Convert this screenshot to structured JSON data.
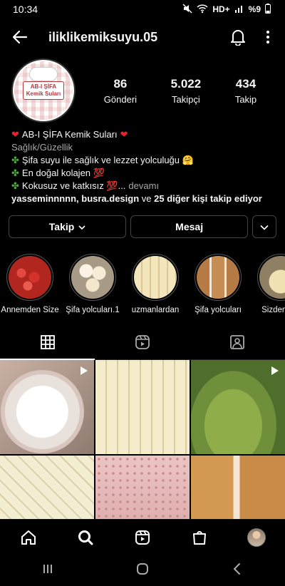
{
  "status_bar": {
    "time": "10:34",
    "network": "HD+",
    "battery": "%9"
  },
  "header": {
    "username": "iliklikemiksuyu.05"
  },
  "profile": {
    "avatar_text_line1": "AB-I ŞİFA",
    "avatar_text_line2": "Kemik Suları",
    "stats": [
      {
        "value": "86",
        "label": "Gönderi"
      },
      {
        "value": "5.022",
        "label": "Takipçi"
      },
      {
        "value": "434",
        "label": "Takip"
      }
    ]
  },
  "bio": {
    "name": "AB-I ŞİFA Kemik Suları",
    "category": "Sağlık/Güzellik",
    "line1": "Şifa suyu ile sağlık ve lezzet yolculuğu 🤗",
    "line2": "En doğal kolajen 💯",
    "line3": "Kokusuz ve katkısız 💯...",
    "more": "devamı",
    "followed_by_users": "yasseminnnnn, busra.design",
    "followed_by_mid": " ve ",
    "followed_by_rest": "25 diğer kişi takip ediyor"
  },
  "actions": {
    "follow_label": "Takip",
    "message_label": "Mesaj"
  },
  "highlights": [
    {
      "label": "Annemden Size",
      "color": "#c9302c"
    },
    {
      "label": "Şifa yolcuları.1",
      "color": "#e8dcc6"
    },
    {
      "label": "uzmanlardan",
      "color": "#e6d7a4"
    },
    {
      "label": "Şifa yolcuları",
      "color": "#c99565"
    },
    {
      "label": "Sizden Ge",
      "color": "#d8c08a"
    }
  ],
  "grid": [
    {
      "desc": "plate",
      "color": "#d9cfc6",
      "reel": true
    },
    {
      "desc": "frozen-cubes",
      "color": "#e5dcb8",
      "reel": false
    },
    {
      "desc": "soup-spoon",
      "color": "#6f8f3b",
      "reel": true
    },
    {
      "desc": "jelly-cubes",
      "color": "#e8e0c0",
      "reel": false
    },
    {
      "desc": "pink-wall",
      "color": "#e3b9b9",
      "reel": false
    },
    {
      "desc": "jars",
      "color": "#c98b47",
      "reel": false
    }
  ]
}
